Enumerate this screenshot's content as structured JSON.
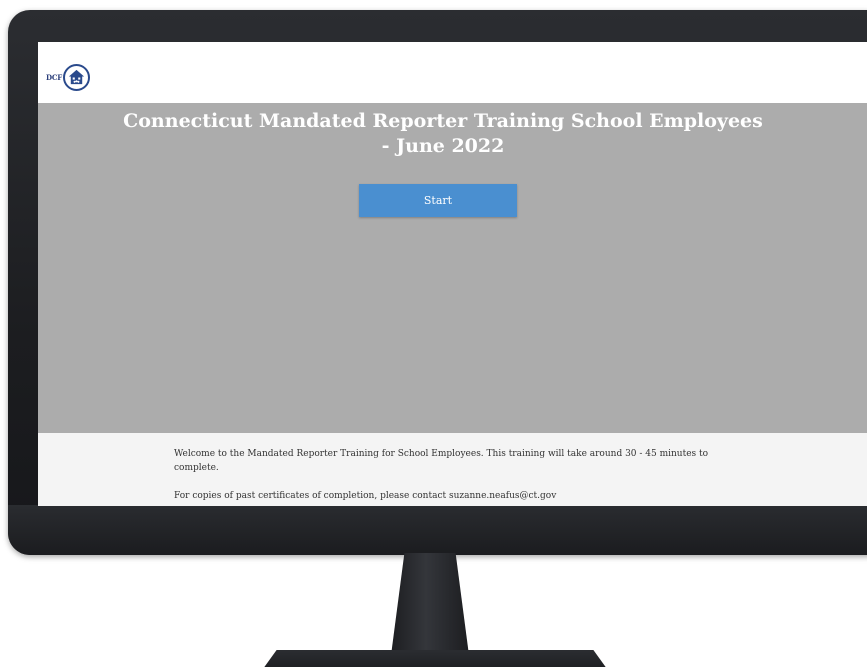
{
  "app": {
    "logo_text": "DCF"
  },
  "hero": {
    "title_line1": "Connecticut Mandated Reporter Training School Employees",
    "title_line2": "- June 2022",
    "start_label": "Start"
  },
  "info": {
    "welcome_text": "Welcome to the Mandated Reporter Training for School Employees.  This training will take around 30 - 45 minutes to complete.",
    "certificates_text": "For copies of past certificates of completion, please contact suzanne.neafus@ct.gov"
  },
  "colors": {
    "hero_background": "#acacac",
    "button_blue": "#4a8fd0",
    "logo_blue": "#2a4a8c",
    "info_background": "#f4f4f4"
  },
  "icons": {
    "logo": "dcf-house-seal-icon"
  }
}
